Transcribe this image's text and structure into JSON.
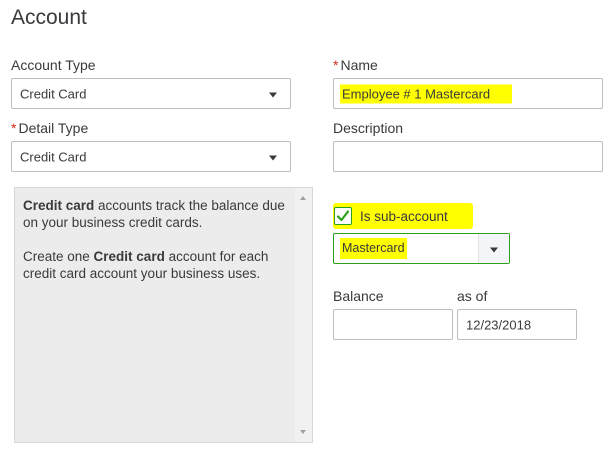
{
  "page": {
    "title": "Account"
  },
  "account_type": {
    "label": "Account Type",
    "value": "Credit Card"
  },
  "detail_type": {
    "required_mark": "*",
    "label": "Detail Type",
    "value": "Credit Card"
  },
  "name": {
    "required_mark": "*",
    "label": "Name",
    "value": "Employee # 1 Mastercard"
  },
  "description": {
    "label": "Description",
    "value": ""
  },
  "info": {
    "para1_bold": "Credit card",
    "para1_rest": " accounts track the balance due on your business credit cards.",
    "para2_start": "Create one ",
    "para2_bold": "Credit card",
    "para2_end": " account for each credit card account your business uses."
  },
  "sub_account": {
    "checked": true,
    "label": "Is sub-account",
    "parent_value": "Mastercard"
  },
  "balance": {
    "label": "Balance",
    "value": ""
  },
  "as_of": {
    "label": "as of",
    "value": "12/23/2018"
  },
  "colors": {
    "accent_green": "#2ca01c",
    "highlight_yellow": "#ffff00",
    "required_red": "#d52b1e"
  },
  "icons": {
    "dropdown": "caret-down-icon",
    "check": "checkmark-icon",
    "scroll_up": "scroll-up-arrow-icon",
    "scroll_down": "scroll-down-arrow-icon"
  }
}
